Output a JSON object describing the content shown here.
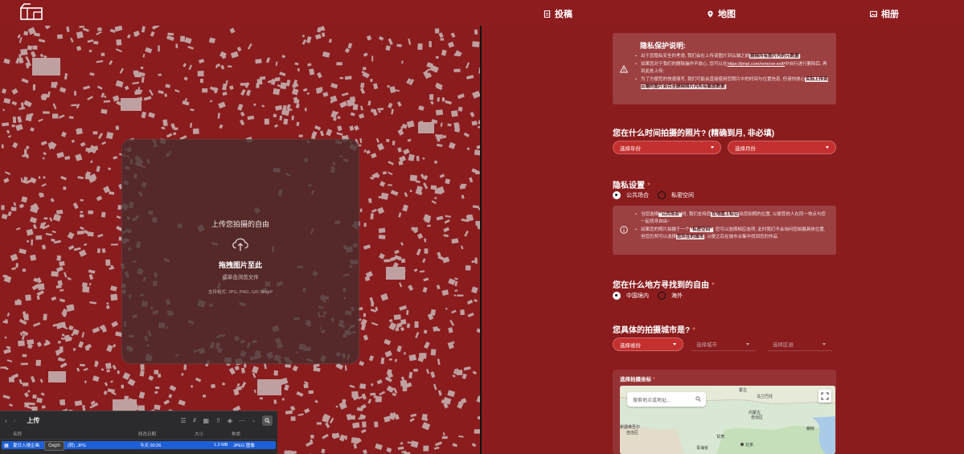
{
  "nav": {
    "post": "投稿",
    "map": "地图",
    "album": "相册"
  },
  "upload": {
    "title": "上传您拍摄的自由",
    "drag": "拖拽图片至此",
    "browse": "或单击浏览文件",
    "formats": "支持格式: JPG, PNG, GIF, WebP"
  },
  "finder": {
    "title": "上传",
    "col_name": "名称",
    "col_modified": "修改日期",
    "col_size": "大小",
    "col_kind": "种类",
    "row_name": "夏日入侵企画",
    "row_ext": "(转) .JPG",
    "row_date": "今天 00:26",
    "row_size": "1.2 MB",
    "row_kind": "JPEG 图像",
    "tooltip": "Geph"
  },
  "privacy": {
    "title": "隐私保护说明:",
    "items": [
      {
        "pre": "出于您隐私安全的考虑, 我们会在上传该图片到云端之前",
        "hl": "删除所有图片内的元数据",
        "post": ";"
      },
      {
        "pre": "如果您对于我们的删除操作不放心, 您可以在",
        "link": "https://jimpl.com/remove-exif/",
        "post": "中自行进行删除后, 再到此处上传;"
      },
      {
        "pre": "为了方便您的快速填写, 我们可能会直接使用您照片中的时间与位置信息, 但请你放心",
        "hl": "实际上传到云端的图片会完全删除照片内所有敏感数据",
        "post": ";"
      }
    ]
  },
  "time_question": {
    "label": "您在什么时间拍摄的照片? (精确到月, 非必填)",
    "year_placeholder": "选择年份",
    "month_placeholder": "选择月份"
  },
  "privacy_setting": {
    "label": "隐私设置",
    "option_public": "公共场合",
    "option_private": "私密空间",
    "selected": "公共场合",
    "items": [
      {
        "pre": "当您选择",
        "hl1": "\"公共场合\"",
        "mid": "时, 我们支持您",
        "hl2": "在地图上标记",
        "post": "出您拍照的位置, 以便其他人在同一地点与您一起找寻自由~"
      },
      {
        "pre": "如果您的照片拍摄于一个",
        "hl1": "\"私密空间\"",
        "mid": ", 您可以选择相应选项, 此时我们不会询问您拍摄具体位置, 但您仍然可以选择",
        "hl2": "您所在的城市",
        "post": ", 以便之后在城市合集中找到您的作品"
      }
    ]
  },
  "location_question": {
    "label": "您在什么地方寻找到的自由",
    "option_domestic": "中国境内",
    "option_overseas": "海外",
    "selected": "中国境内"
  },
  "city_question": {
    "label": "您具体的拍摄城市是?",
    "province_placeholder": "选择省份",
    "city_placeholder": "选择城市",
    "district_placeholder": "选择区县"
  },
  "map_picker": {
    "label": "选择拍摄坐标",
    "search_placeholder": "搜索地点或地址...",
    "labels": [
      "蒙古",
      "乌兰巴托",
      "新疆维吾尔",
      "自治区",
      "青海省",
      "北京",
      "朝鲜",
      "内蒙古",
      "自治区",
      "甘肃"
    ]
  },
  "colors": {
    "background": "#8a1c1e",
    "accent": "#c4302f",
    "finder_selection": "#1f5fd6"
  }
}
